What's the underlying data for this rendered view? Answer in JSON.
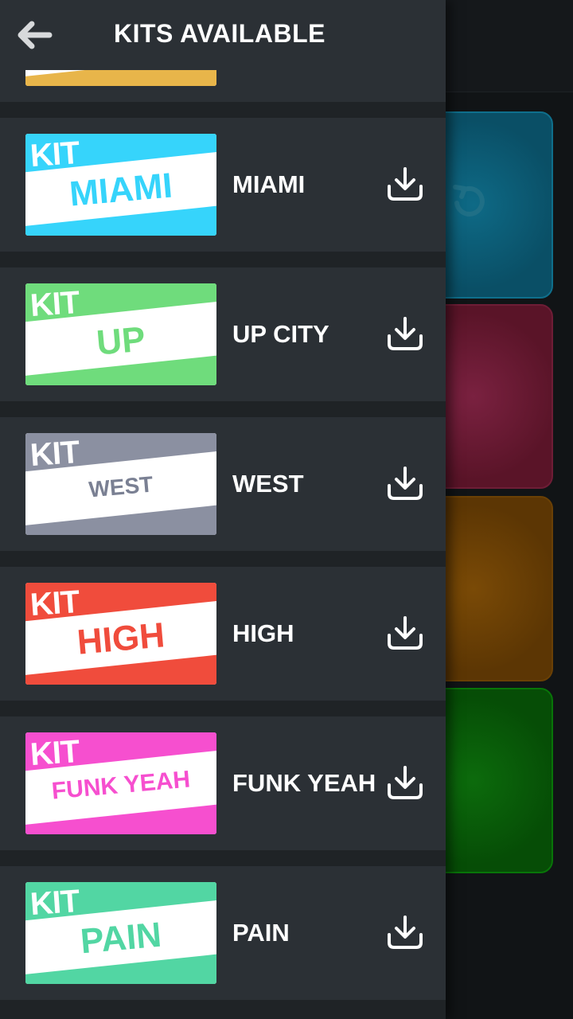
{
  "header": {
    "title": "KITS AVAILABLE"
  },
  "colors": {
    "drawer_bg": "#2b3035",
    "miami": "#36d4fb",
    "up_city": "#6fdc7c",
    "west": "#8b90a1",
    "high": "#f04c3c",
    "funk_yeah": "#f64fcf",
    "pain": "#52d6a3",
    "partial": "#e8b54a"
  },
  "kits": [
    {
      "name": "MIAMI",
      "kit_text": "KIT",
      "thumb_text": "MIAMI",
      "icon": "download-icon"
    },
    {
      "name": "UP CITY",
      "kit_text": "KIT",
      "thumb_text": "UP",
      "icon": "download-icon"
    },
    {
      "name": "WEST",
      "kit_text": "KIT",
      "thumb_text": "WEST",
      "icon": "download-icon"
    },
    {
      "name": "HIGH",
      "kit_text": "KIT",
      "thumb_text": "HIGH",
      "icon": "download-icon"
    },
    {
      "name": "FUNK YEAH",
      "kit_text": "KIT",
      "thumb_text": "FUNK YEAH",
      "icon": "download-icon"
    },
    {
      "name": "PAIN",
      "kit_text": "KIT",
      "thumb_text": "PAIN",
      "icon": "download-icon"
    }
  ]
}
